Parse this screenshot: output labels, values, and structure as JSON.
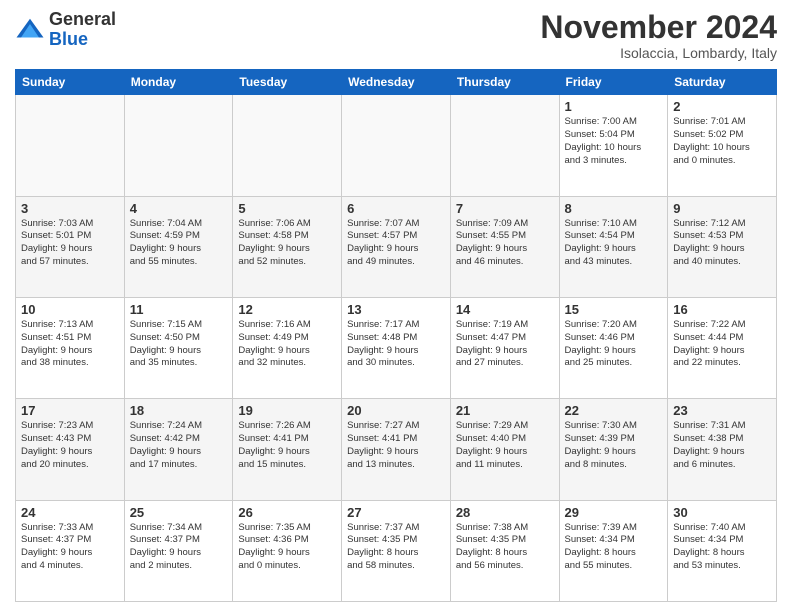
{
  "header": {
    "logo_line1": "General",
    "logo_line2": "Blue",
    "month_title": "November 2024",
    "location": "Isolaccia, Lombardy, Italy"
  },
  "weekdays": [
    "Sunday",
    "Monday",
    "Tuesday",
    "Wednesday",
    "Thursday",
    "Friday",
    "Saturday"
  ],
  "weeks": [
    [
      {
        "day": "",
        "info": ""
      },
      {
        "day": "",
        "info": ""
      },
      {
        "day": "",
        "info": ""
      },
      {
        "day": "",
        "info": ""
      },
      {
        "day": "",
        "info": ""
      },
      {
        "day": "1",
        "info": "Sunrise: 7:00 AM\nSunset: 5:04 PM\nDaylight: 10 hours\nand 3 minutes."
      },
      {
        "day": "2",
        "info": "Sunrise: 7:01 AM\nSunset: 5:02 PM\nDaylight: 10 hours\nand 0 minutes."
      }
    ],
    [
      {
        "day": "3",
        "info": "Sunrise: 7:03 AM\nSunset: 5:01 PM\nDaylight: 9 hours\nand 57 minutes."
      },
      {
        "day": "4",
        "info": "Sunrise: 7:04 AM\nSunset: 4:59 PM\nDaylight: 9 hours\nand 55 minutes."
      },
      {
        "day": "5",
        "info": "Sunrise: 7:06 AM\nSunset: 4:58 PM\nDaylight: 9 hours\nand 52 minutes."
      },
      {
        "day": "6",
        "info": "Sunrise: 7:07 AM\nSunset: 4:57 PM\nDaylight: 9 hours\nand 49 minutes."
      },
      {
        "day": "7",
        "info": "Sunrise: 7:09 AM\nSunset: 4:55 PM\nDaylight: 9 hours\nand 46 minutes."
      },
      {
        "day": "8",
        "info": "Sunrise: 7:10 AM\nSunset: 4:54 PM\nDaylight: 9 hours\nand 43 minutes."
      },
      {
        "day": "9",
        "info": "Sunrise: 7:12 AM\nSunset: 4:53 PM\nDaylight: 9 hours\nand 40 minutes."
      }
    ],
    [
      {
        "day": "10",
        "info": "Sunrise: 7:13 AM\nSunset: 4:51 PM\nDaylight: 9 hours\nand 38 minutes."
      },
      {
        "day": "11",
        "info": "Sunrise: 7:15 AM\nSunset: 4:50 PM\nDaylight: 9 hours\nand 35 minutes."
      },
      {
        "day": "12",
        "info": "Sunrise: 7:16 AM\nSunset: 4:49 PM\nDaylight: 9 hours\nand 32 minutes."
      },
      {
        "day": "13",
        "info": "Sunrise: 7:17 AM\nSunset: 4:48 PM\nDaylight: 9 hours\nand 30 minutes."
      },
      {
        "day": "14",
        "info": "Sunrise: 7:19 AM\nSunset: 4:47 PM\nDaylight: 9 hours\nand 27 minutes."
      },
      {
        "day": "15",
        "info": "Sunrise: 7:20 AM\nSunset: 4:46 PM\nDaylight: 9 hours\nand 25 minutes."
      },
      {
        "day": "16",
        "info": "Sunrise: 7:22 AM\nSunset: 4:44 PM\nDaylight: 9 hours\nand 22 minutes."
      }
    ],
    [
      {
        "day": "17",
        "info": "Sunrise: 7:23 AM\nSunset: 4:43 PM\nDaylight: 9 hours\nand 20 minutes."
      },
      {
        "day": "18",
        "info": "Sunrise: 7:24 AM\nSunset: 4:42 PM\nDaylight: 9 hours\nand 17 minutes."
      },
      {
        "day": "19",
        "info": "Sunrise: 7:26 AM\nSunset: 4:41 PM\nDaylight: 9 hours\nand 15 minutes."
      },
      {
        "day": "20",
        "info": "Sunrise: 7:27 AM\nSunset: 4:41 PM\nDaylight: 9 hours\nand 13 minutes."
      },
      {
        "day": "21",
        "info": "Sunrise: 7:29 AM\nSunset: 4:40 PM\nDaylight: 9 hours\nand 11 minutes."
      },
      {
        "day": "22",
        "info": "Sunrise: 7:30 AM\nSunset: 4:39 PM\nDaylight: 9 hours\nand 8 minutes."
      },
      {
        "day": "23",
        "info": "Sunrise: 7:31 AM\nSunset: 4:38 PM\nDaylight: 9 hours\nand 6 minutes."
      }
    ],
    [
      {
        "day": "24",
        "info": "Sunrise: 7:33 AM\nSunset: 4:37 PM\nDaylight: 9 hours\nand 4 minutes."
      },
      {
        "day": "25",
        "info": "Sunrise: 7:34 AM\nSunset: 4:37 PM\nDaylight: 9 hours\nand 2 minutes."
      },
      {
        "day": "26",
        "info": "Sunrise: 7:35 AM\nSunset: 4:36 PM\nDaylight: 9 hours\nand 0 minutes."
      },
      {
        "day": "27",
        "info": "Sunrise: 7:37 AM\nSunset: 4:35 PM\nDaylight: 8 hours\nand 58 minutes."
      },
      {
        "day": "28",
        "info": "Sunrise: 7:38 AM\nSunset: 4:35 PM\nDaylight: 8 hours\nand 56 minutes."
      },
      {
        "day": "29",
        "info": "Sunrise: 7:39 AM\nSunset: 4:34 PM\nDaylight: 8 hours\nand 55 minutes."
      },
      {
        "day": "30",
        "info": "Sunrise: 7:40 AM\nSunset: 4:34 PM\nDaylight: 8 hours\nand 53 minutes."
      }
    ]
  ]
}
